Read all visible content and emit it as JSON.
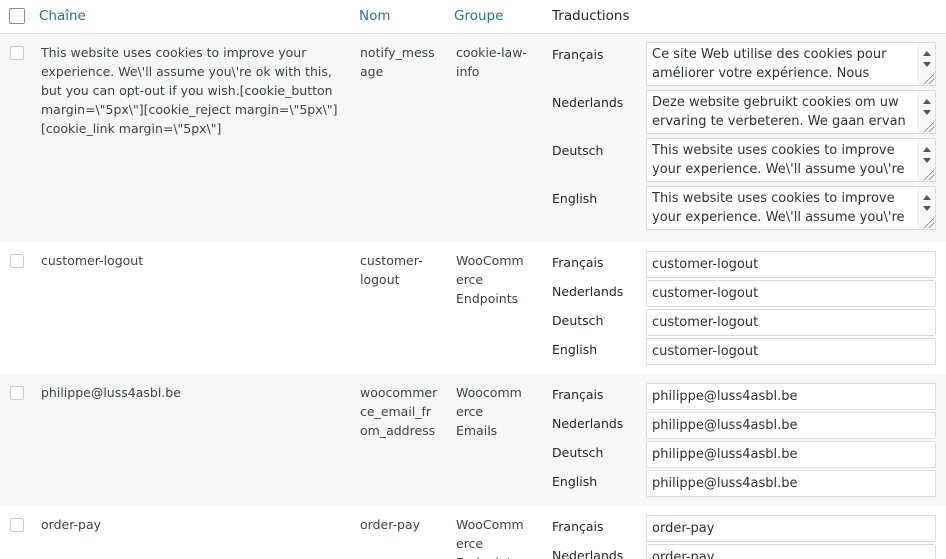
{
  "header": {
    "col_string": "Chaîne",
    "col_name": "Nom",
    "col_group": "Groupe",
    "col_translations": "Traductions"
  },
  "rows": [
    {
      "string": "This website uses cookies to improve your experience. We\\'ll assume you\\'re ok with this, but you can opt-out if you wish.[cookie_button margin=\\\"5px\\\"][cookie_reject margin=\\\"5px\\\"][cookie_link margin=\\\"5px\\\"]",
      "name": "notify_message",
      "group": "cookie-law-info",
      "translations": [
        {
          "lang": "Français",
          "value": "Ce site Web utilise des cookies pour améliorer votre expérience. Nous"
        },
        {
          "lang": "Nederlands",
          "value": "Deze website gebruikt cookies om uw ervaring te verbeteren. We gaan ervan uit"
        },
        {
          "lang": "Deutsch",
          "value": "This website uses cookies to improve your experience. We\\'ll assume you\\'re ok with"
        },
        {
          "lang": "English",
          "value": "This website uses cookies to improve your experience. We\\'ll assume you\\'re ok with"
        }
      ]
    },
    {
      "string": "customer-logout",
      "name": "customer-logout",
      "group": "WooCommerce Endpoints",
      "translations": [
        {
          "lang": "Français",
          "value": "customer-logout"
        },
        {
          "lang": "Nederlands",
          "value": "customer-logout"
        },
        {
          "lang": "Deutsch",
          "value": "customer-logout"
        },
        {
          "lang": "English",
          "value": "customer-logout"
        }
      ]
    },
    {
      "string": "philippe@luss4asbl.be",
      "name": "woocommerce_email_from_address",
      "group": "Woocommerce Emails",
      "translations": [
        {
          "lang": "Français",
          "value": "philippe@luss4asbl.be"
        },
        {
          "lang": "Nederlands",
          "value": "philippe@luss4asbl.be"
        },
        {
          "lang": "Deutsch",
          "value": "philippe@luss4asbl.be"
        },
        {
          "lang": "English",
          "value": "philippe@luss4asbl.be"
        }
      ]
    },
    {
      "string": "order-pay",
      "name": "order-pay",
      "group": "WooCommerce Endpoints",
      "translations": [
        {
          "lang": "Français",
          "value": "order-pay"
        },
        {
          "lang": "Nederlands",
          "value": "order-pay"
        }
      ]
    }
  ]
}
